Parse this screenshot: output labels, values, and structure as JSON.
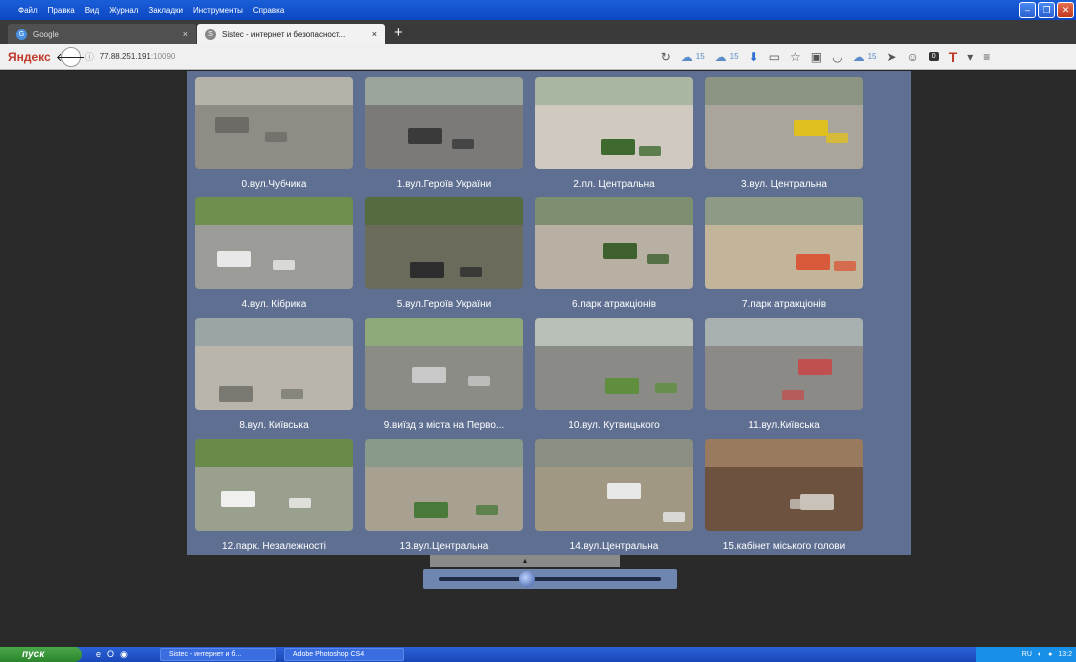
{
  "menu": [
    "Файл",
    "Правка",
    "Вид",
    "Журнал",
    "Закладки",
    "Инструменты",
    "Справка"
  ],
  "tabs": [
    {
      "label": "Google",
      "close": "×"
    },
    {
      "label": "Sistec - интернет и безопасност...",
      "close": "×"
    }
  ],
  "new_tab": "+",
  "nav": {
    "brand": "Яндекс",
    "url_host": "77.88.251.191",
    "url_port": ":10090",
    "counts": [
      "15",
      "15",
      "15"
    ]
  },
  "cameras": [
    {
      "label": "0.вул.Чубчика"
    },
    {
      "label": "1.вул.Героїв України"
    },
    {
      "label": "2.пл. Центральна"
    },
    {
      "label": "3.вул. Центральна"
    },
    {
      "label": "4.вул. Кібрика"
    },
    {
      "label": "5.вул.Героїв України"
    },
    {
      "label": "6.парк атракціонів"
    },
    {
      "label": "7.парк атракціонів"
    },
    {
      "label": "8.вул. Київська"
    },
    {
      "label": "9.виїзд з міста на Перво..."
    },
    {
      "label": "10.вул. Кутвицького"
    },
    {
      "label": "11.вул.Київська"
    },
    {
      "label": "12.парк. Незалежності"
    },
    {
      "label": "13.вул.Центральна"
    },
    {
      "label": "14.вул.Центральна"
    },
    {
      "label": "15.кабінет міського голови"
    }
  ],
  "taskbar": {
    "start": "пуск",
    "tasks": [
      "Sistec - интернет и б...",
      "Adobe Photoshop CS4"
    ],
    "lang": "RU",
    "clock": "13:2"
  }
}
